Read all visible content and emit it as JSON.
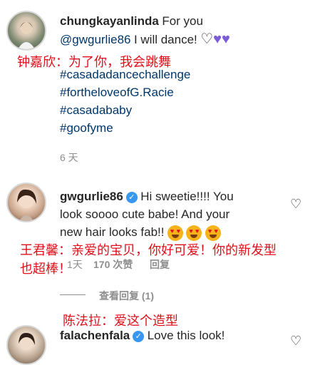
{
  "comment1": {
    "username": "chungkayanlinda",
    "text_start": "For you",
    "mention": "@gwgurlie86",
    "text_end": "I will dance!",
    "hearts": [
      "♡",
      "♥",
      "♥"
    ],
    "caption_cn": "钟嘉欣：为了你，我会跳舞",
    "hashtags": [
      "#casadadancechallenge",
      "#fortheloveofG.Racie",
      "#casadababy",
      "#goofyme"
    ],
    "time": "6 天"
  },
  "comment2": {
    "username": "gwgurlie86",
    "verified_icon": "✓",
    "lines": [
      "Hi sweetie!!!! You",
      "look soooo cute babe! And your",
      "new hair looks fab!!"
    ],
    "caption_cn_line1": "王君馨：亲爱的宝贝，你好可爱！你的新发型",
    "caption_cn_line2": "也超棒！",
    "time": "1天",
    "likes": "170 次赞",
    "reply": "回复",
    "like_icon": "♡",
    "view_replies": "查看回复 (1)"
  },
  "comment3": {
    "caption_cn": "陈法拉：爱这个造型",
    "username": "falachenfala",
    "verified_icon": "✓",
    "text": "Love this look!",
    "like_icon": "♡"
  },
  "colors": {
    "accent_red": "#e0101b",
    "link_blue": "#00376b",
    "purple_heart": "#7b5bd6",
    "verified_blue": "#3897f0"
  }
}
